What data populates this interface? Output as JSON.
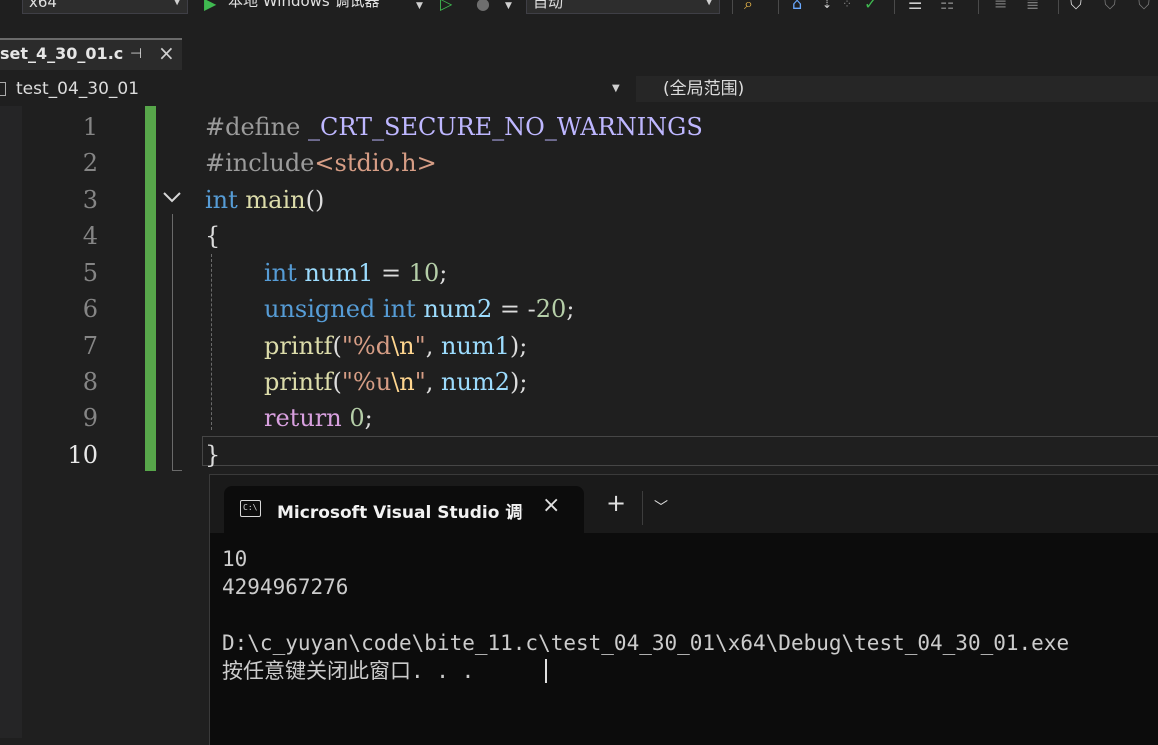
{
  "toolbar": {
    "platform": "x64",
    "run_label": "本地 Windows 调试器",
    "config": "自动"
  },
  "document_tab": {
    "title": "set_4_30_01.c"
  },
  "navbar": {
    "project": "test_04_30_01",
    "scope": "(全局范围)"
  },
  "editor": {
    "line_numbers": [
      "1",
      "2",
      "3",
      "4",
      "5",
      "6",
      "7",
      "8",
      "9",
      "10"
    ],
    "current_line": "10",
    "code": {
      "l1_directive": "#define",
      "l1_macro": "_CRT_SECURE_NO_WARNINGS",
      "l2_directive": "#include",
      "l2_header": "<stdio.h>",
      "l3_type": "int",
      "l3_func": "main",
      "l3_parens": "()",
      "l4_brace": "{",
      "l5_type": "int",
      "l5_var": "num1",
      "l5_op": " = ",
      "l5_num": "10",
      "l5_end": ";",
      "l6_type": "unsigned int",
      "l6_var": "num2",
      "l6_op": " = -",
      "l6_num": "20",
      "l6_end": ";",
      "l7_func": "printf",
      "l7_open": "(",
      "l7_str_a": "\"%d",
      "l7_esc": "\\n",
      "l7_str_b": "\"",
      "l7_sep": ", ",
      "l7_var": "num1",
      "l7_end": ");",
      "l8_func": "printf",
      "l8_open": "(",
      "l8_str_a": "\"%u",
      "l8_esc": "\\n",
      "l8_str_b": "\"",
      "l8_sep": ", ",
      "l8_var": "num2",
      "l8_end": ");",
      "l9_kw": "return",
      "l9_sp": " ",
      "l9_num": "0",
      "l9_end": ";",
      "l10_brace": "}"
    }
  },
  "console": {
    "tab_title": "Microsoft Visual Studio 调试控",
    "icon_text": "C:\\",
    "output": [
      "10",
      "4294967276",
      "",
      "D:\\c_yuyan\\code\\bite_11.c\\test_04_30_01\\x64\\Debug\\test_04_30_01.exe",
      "按任意键关闭此窗口. . ."
    ]
  }
}
